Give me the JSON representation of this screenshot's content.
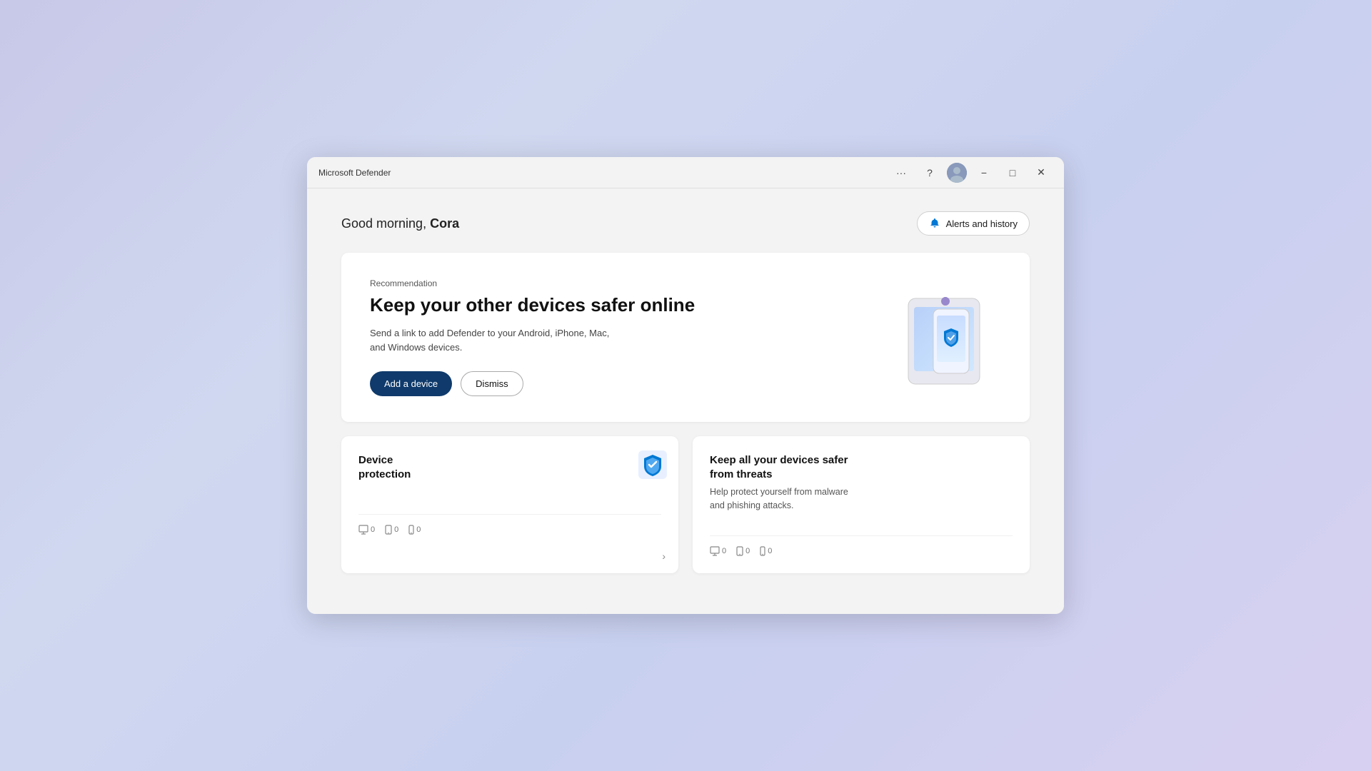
{
  "window": {
    "title": "Microsoft Defender",
    "controls": {
      "more_label": "···",
      "help_label": "?",
      "minimize_label": "−",
      "maximize_label": "□",
      "close_label": "✕"
    }
  },
  "header": {
    "greeting": "Good morning, ",
    "user_name": "Cora",
    "alerts_button_label": "Alerts and history"
  },
  "recommendation": {
    "label": "Recommendation",
    "title": "Keep your other devices safer online",
    "description": "Send a link to add Defender to your Android, iPhone, Mac,\nand Windows devices.",
    "add_device_label": "Add a device",
    "dismiss_label": "Dismiss"
  },
  "cards": [
    {
      "title": "Device\nprotection",
      "description": "",
      "device_counts": [
        "0",
        "0",
        "0"
      ],
      "has_chevron": true
    },
    {
      "title": "Keep all your devices safer\nfrom threats",
      "description": "Help protect yourself from malware\nand phishing attacks.",
      "device_counts": [
        "0",
        "0",
        "0"
      ],
      "has_chevron": false
    }
  ],
  "colors": {
    "primary_btn_bg": "#0f3a6b",
    "accent": "#0078d4",
    "window_bg": "#f3f3f3",
    "card_bg": "#ffffff"
  }
}
